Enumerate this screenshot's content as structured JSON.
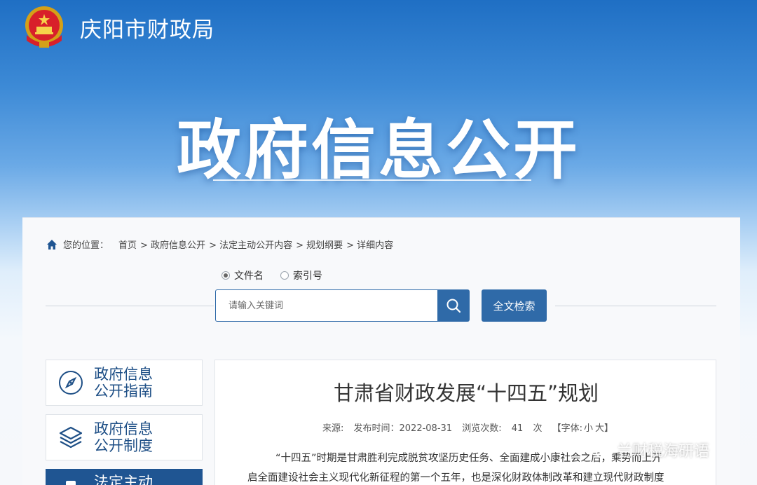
{
  "header": {
    "site_title": "庆阳市财政局",
    "emblem_icon": "national-emblem-icon"
  },
  "hero": {
    "title": "政府信息公开"
  },
  "breadcrumb": {
    "label": "您的位置：",
    "items": [
      "首页",
      "> 政府信息公开",
      "> 法定主动公开内容",
      "> 规划纲要",
      "> 详细内容"
    ]
  },
  "search": {
    "radio_options": [
      "文件名",
      "索引号"
    ],
    "selected": "文件名",
    "placeholder": "请输入关键词",
    "fulltext_label": "全文检索"
  },
  "sidebar": {
    "items": [
      {
        "line1": "政府信息",
        "line2": "公开指南",
        "icon": "compass-icon"
      },
      {
        "line1": "政府信息",
        "line2": "公开制度",
        "icon": "layers-icon"
      },
      {
        "line1": "法定主动",
        "line2": "",
        "icon": "document-icon"
      }
    ]
  },
  "article": {
    "title": "甘肃省财政发展“十四五”规划",
    "source_label": "来源:",
    "date_label": "发布时间：2022-08-31",
    "views_label": "浏览次数:",
    "views": "41",
    "views_unit": "次",
    "font_label": "【字体:",
    "font_small": "小",
    "font_large": "大】",
    "para1": "“十四五”时期是甘肃胜利完成脱贫攻坚历史任务、全面建成小康社会之后，乘势而上开",
    "para2": "启全面建设社会主义现代化新征程的第一个五年，也是深化财政体制改革和建立现代财政制度"
  },
  "watermark": {
    "text": "兰财税海研语"
  },
  "colors": {
    "brand_blue": "#2f6aa8",
    "sidebar_text": "#1e4f86",
    "active_bg": "#1f5592"
  }
}
